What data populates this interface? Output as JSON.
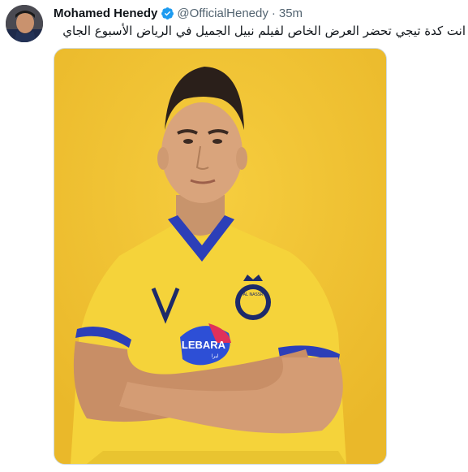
{
  "tweet": {
    "author": {
      "name": "Mohamed Henedy",
      "handle": "@OfficialHenedy",
      "verified": true
    },
    "separator": "·",
    "time": "35m",
    "text": "انت كدة تيجي تحضر العرض الخاص لفيلم نبيل الجميل في الرياض الأسبوع الجاي",
    "media": {
      "jersey_sponsor": "LEBARA",
      "jersey_sponsor_sub": "لبرا",
      "crest_text": "AL NASSR"
    }
  },
  "colors": {
    "verified_blue": "#1d9bf0",
    "background_yellow": "#f3c332",
    "jersey_yellow": "#f5d33a",
    "jersey_blue": "#2c3fb8"
  }
}
